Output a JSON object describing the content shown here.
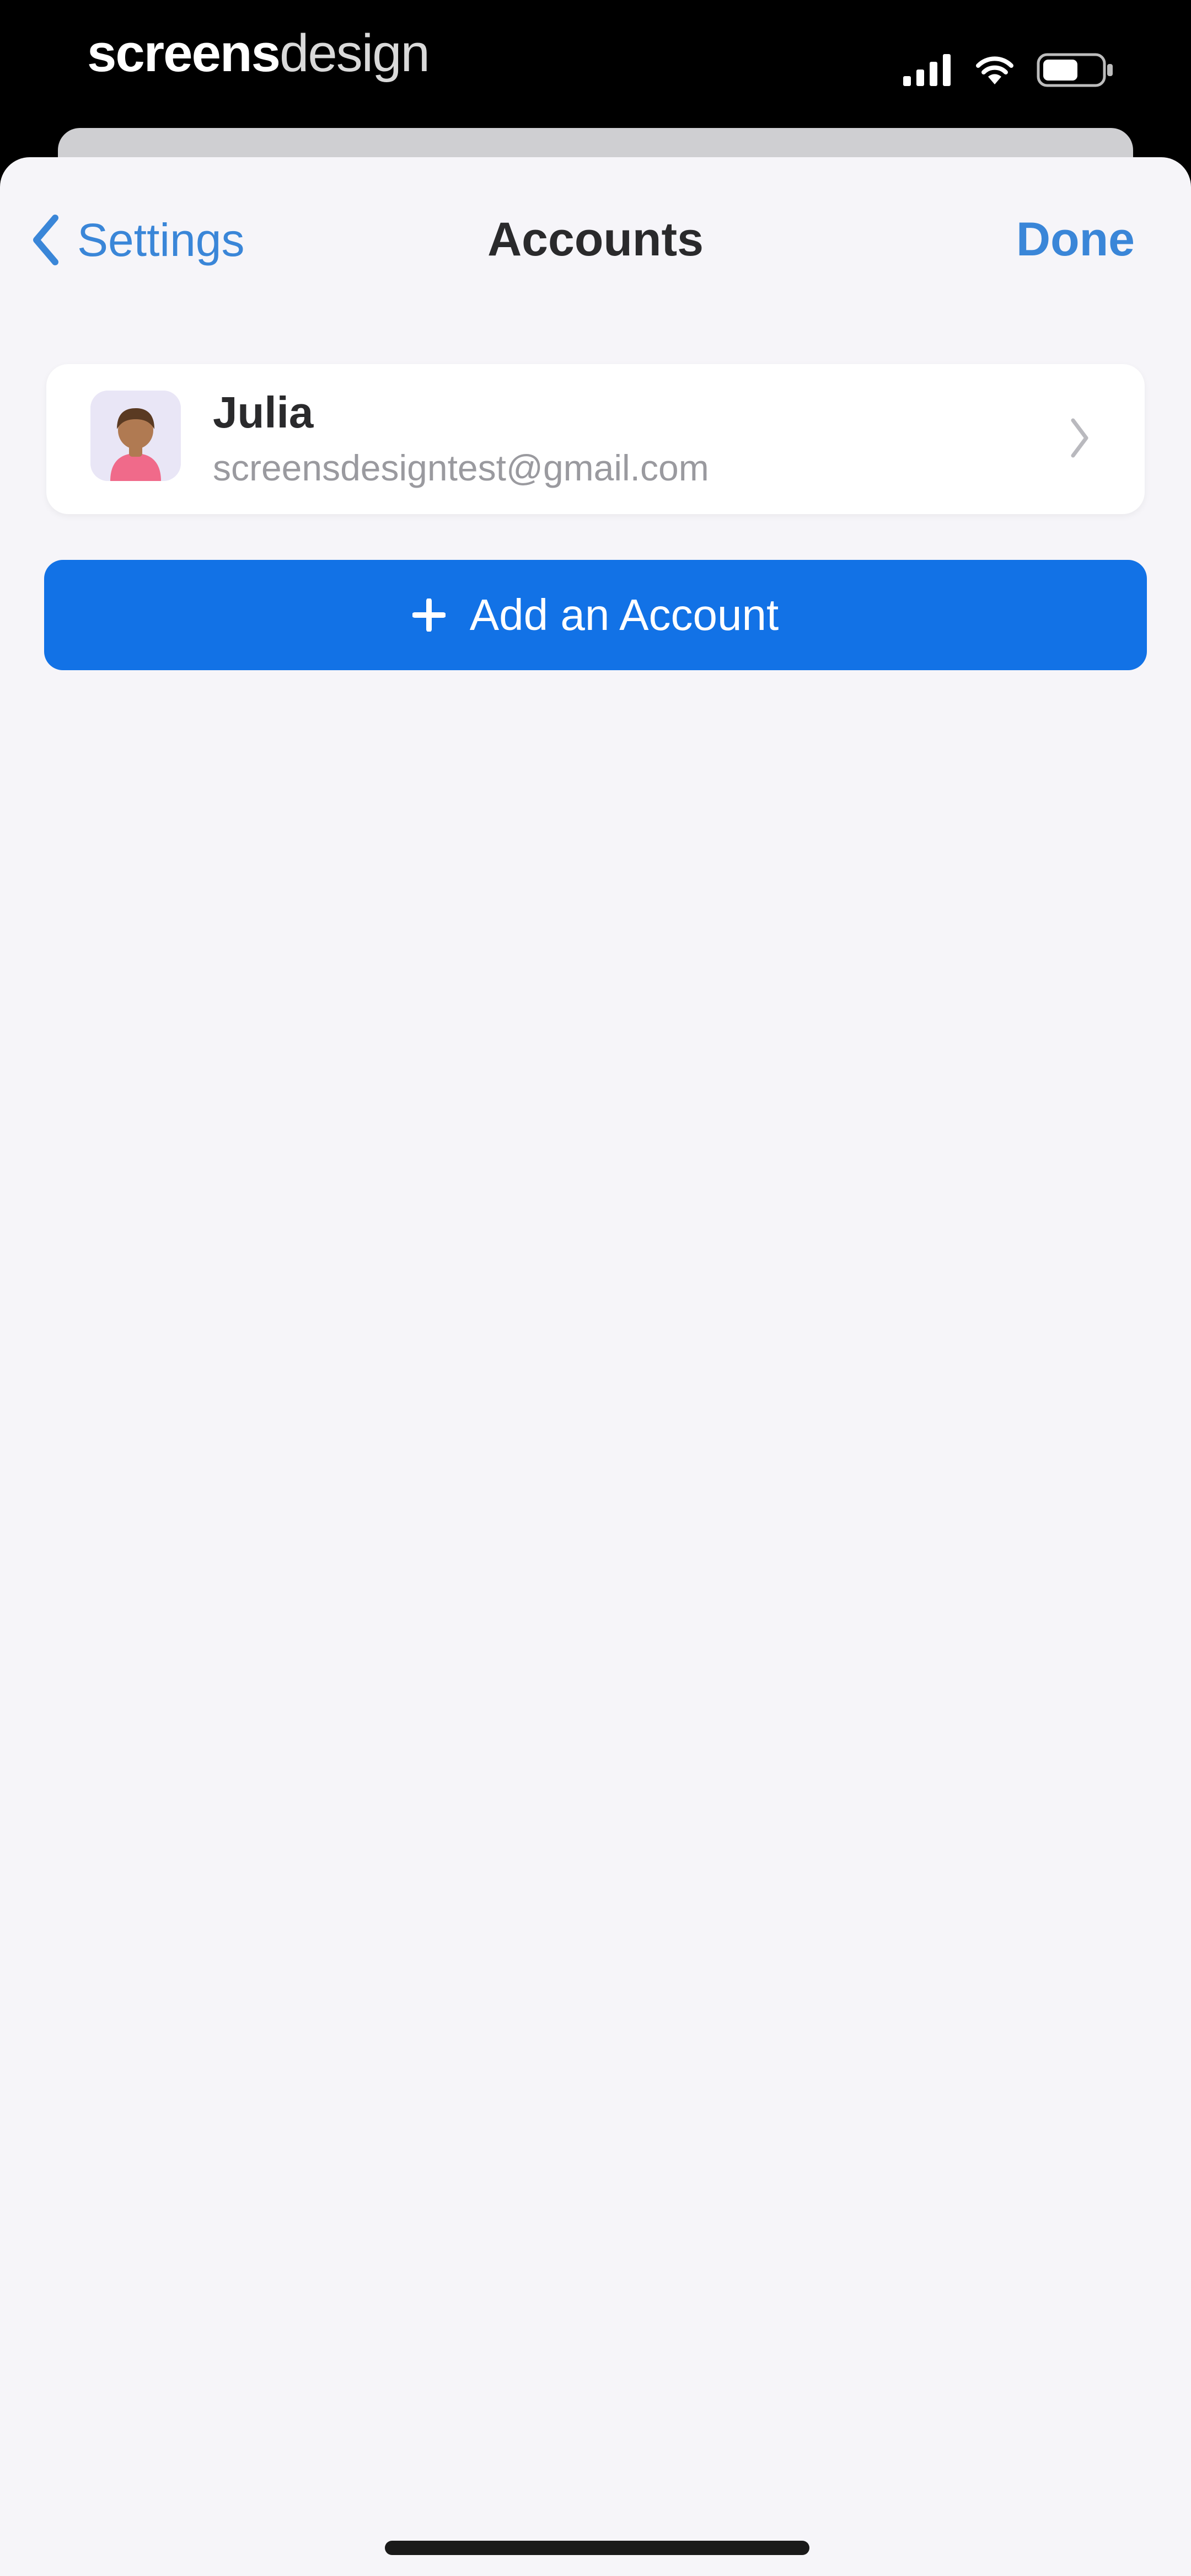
{
  "status_bar": {
    "brand_part1": "screens",
    "brand_part2": "design",
    "icons": [
      "cellular-signal-icon",
      "wifi-icon",
      "battery-icon"
    ]
  },
  "nav": {
    "back_label": "Settings",
    "title": "Accounts",
    "done_label": "Done"
  },
  "accounts": [
    {
      "name": "Julia",
      "email": "screensdesigntest@gmail.com",
      "avatar": "avatar-icon"
    }
  ],
  "add_account": {
    "label": "Add an Account",
    "icon": "plus-icon"
  },
  "colors": {
    "accent": "#3a86d8",
    "button_blue": "#1272e6",
    "background": "#f6f5f9",
    "card": "#ffffff"
  }
}
